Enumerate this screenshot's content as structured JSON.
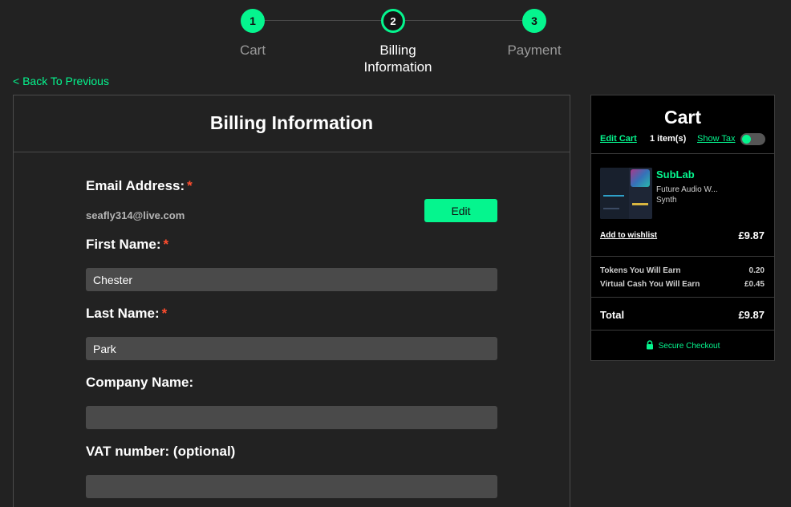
{
  "stepper": {
    "steps": [
      {
        "number": "1",
        "label": "Cart"
      },
      {
        "number": "2",
        "label_line1": "Billing",
        "label_line2": "Information"
      },
      {
        "number": "3",
        "label": "Payment"
      }
    ],
    "active_step": 2
  },
  "back_link": "< Back To Previous",
  "billing": {
    "title": "Billing Information",
    "email_label": "Email Address:",
    "email_value": "seafly314@live.com",
    "edit_button": "Edit",
    "first_name_label": "First Name:",
    "first_name_value": "Chester",
    "last_name_label": "Last Name:",
    "last_name_value": "Park",
    "company_label": "Company Name:",
    "company_value": "",
    "vat_label": "VAT number: (optional)",
    "vat_value": "",
    "required_marker": "*"
  },
  "cart": {
    "title": "Cart",
    "edit_cart": "Edit Cart",
    "items_count": "1 item(s)",
    "show_tax": "Show Tax",
    "show_tax_enabled": true,
    "product": {
      "name": "SubLab",
      "description": "Future Audio W...",
      "category": "Synth",
      "add_to_wishlist": "Add to wishlist",
      "price": "£9.87"
    },
    "tokens_label": "Tokens You Will Earn",
    "tokens_value": "0.20",
    "virtual_cash_label": "Virtual Cash You Will Earn",
    "virtual_cash_value": "£0.45",
    "total_label": "Total",
    "total_value": "£9.87",
    "secure_checkout": "Secure Checkout"
  },
  "colors": {
    "accent": "#05f58e",
    "background": "#222222",
    "cart_background": "#000000",
    "input_background": "#4a4a4a",
    "required": "#ff4d2e"
  },
  "icons": [
    "lock-icon"
  ]
}
